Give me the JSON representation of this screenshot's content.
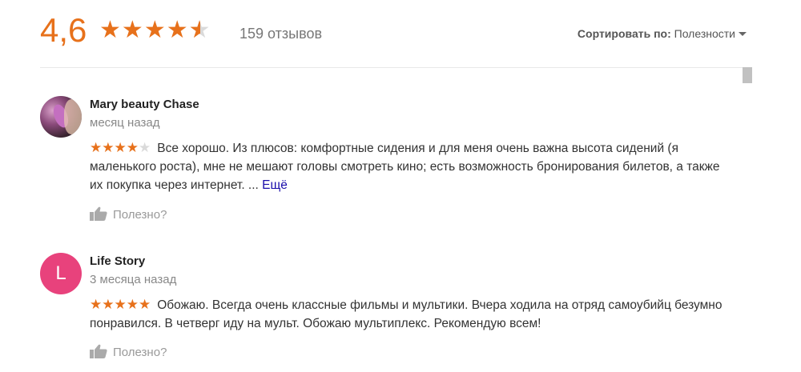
{
  "summary": {
    "rating": "4,6",
    "stars": [
      "full",
      "full",
      "full",
      "full",
      "half"
    ],
    "review_count": "159 отзывов"
  },
  "sort": {
    "label": "Сортировать по:",
    "value": "Полезности"
  },
  "reviews": [
    {
      "author": "Mary beauty Chase",
      "date": "месяц назад",
      "rating": 4,
      "stars": [
        "full",
        "full",
        "full",
        "full",
        "empty"
      ],
      "text": "Все хорошо. Из плюсов: комфортные сидения и для меня очень важна высота сидений (я маленького роста), мне не мешают головы смотреть кино; есть возможность бронирования билетов, а также их покупка через интернет. ...",
      "more_label": "Ещё",
      "helpful_label": "Полезно?",
      "avatar_letter": ""
    },
    {
      "author": "Life Story",
      "date": "3 месяца назад",
      "rating": 5,
      "stars": [
        "full",
        "full",
        "full",
        "full",
        "full"
      ],
      "text": "Обожаю. Всегда очень классные фильмы и мультики. Вчера ходила на отряд самоубийц безумно понравился. В четверг иду на мульт. Обожаю мультиплекс. Рекомендую всем!",
      "more_label": "",
      "helpful_label": "Полезно?",
      "avatar_letter": "L"
    }
  ],
  "colors": {
    "star": "#e7711b",
    "star_empty": "#dadada",
    "avatar_letter_bg": "#e8427c",
    "link": "#1a0dab"
  },
  "icons": {
    "thumb": "thumb-up-icon",
    "caret": "chevron-down-icon"
  }
}
